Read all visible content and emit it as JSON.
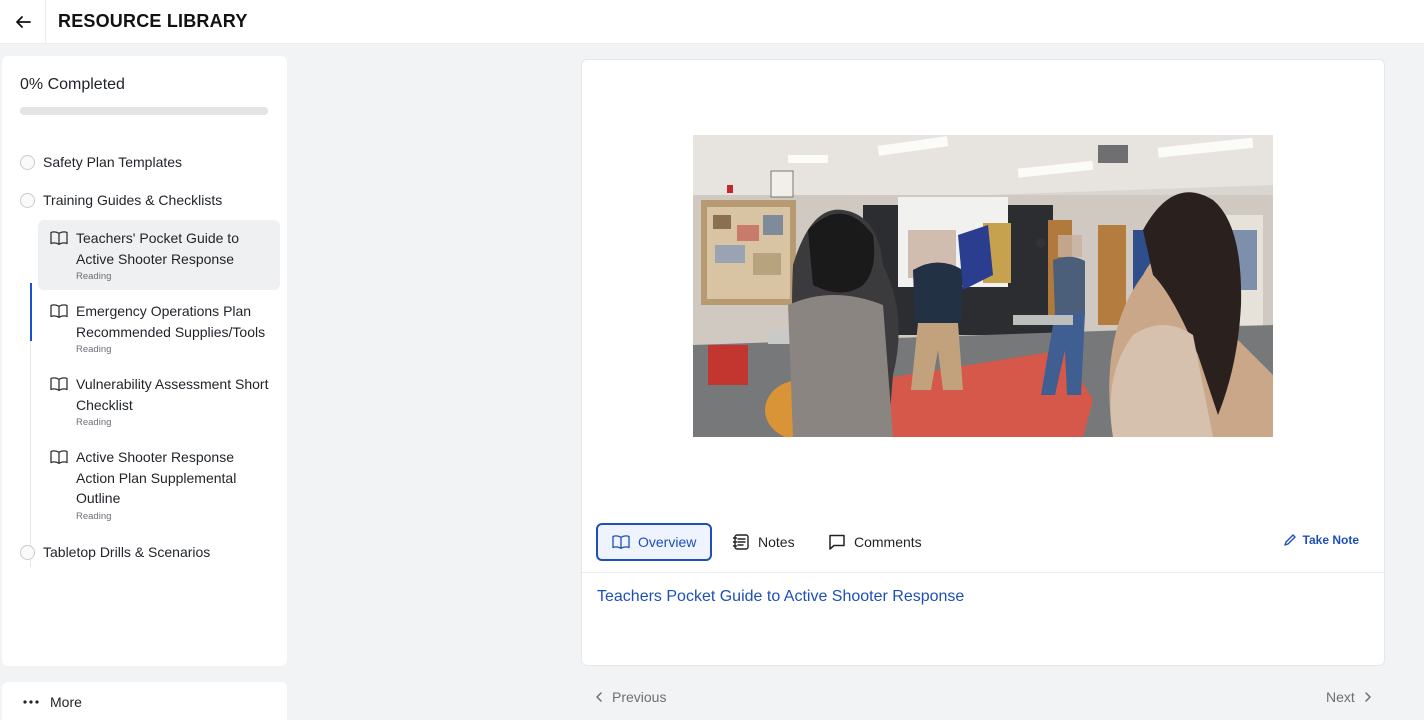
{
  "header": {
    "back_icon": "arrow-left-icon",
    "title": "RESOURCE LIBRARY"
  },
  "sidebar": {
    "progress": {
      "label": "0% Completed",
      "percent": 0
    },
    "sections": [
      {
        "label": "Safety Plan Templates"
      },
      {
        "label": "Training Guides & Checklists"
      },
      {
        "label": "Tabletop Drills & Scenarios"
      }
    ],
    "items": [
      {
        "title": "Teachers' Pocket Guide to Active Shooter Response",
        "type": "Reading",
        "active": true
      },
      {
        "title": "Emergency Operations Plan Recommended Supplies/Tools",
        "type": "Reading",
        "active": false
      },
      {
        "title": "Vulnerability Assessment Short Checklist",
        "type": "Reading",
        "active": false
      },
      {
        "title": "Active Shooter Response Action Plan Supplemental Outline",
        "type": "Reading",
        "active": false
      }
    ],
    "more_label": "More"
  },
  "content": {
    "tabs": [
      {
        "label": "Overview",
        "icon": "book-open-icon",
        "active": true
      },
      {
        "label": "Notes",
        "icon": "notes-icon",
        "active": false
      },
      {
        "label": "Comments",
        "icon": "comment-icon",
        "active": false
      }
    ],
    "take_note_label": "Take Note",
    "overview_link": "Teachers Pocket Guide to Active Shooter Response"
  },
  "pager": {
    "previous_label": "Previous",
    "next_label": "Next"
  },
  "colors": {
    "accent": "#1e4fb8",
    "active_item_bg": "#eff0f2",
    "page_bg": "#f2f3f4"
  }
}
